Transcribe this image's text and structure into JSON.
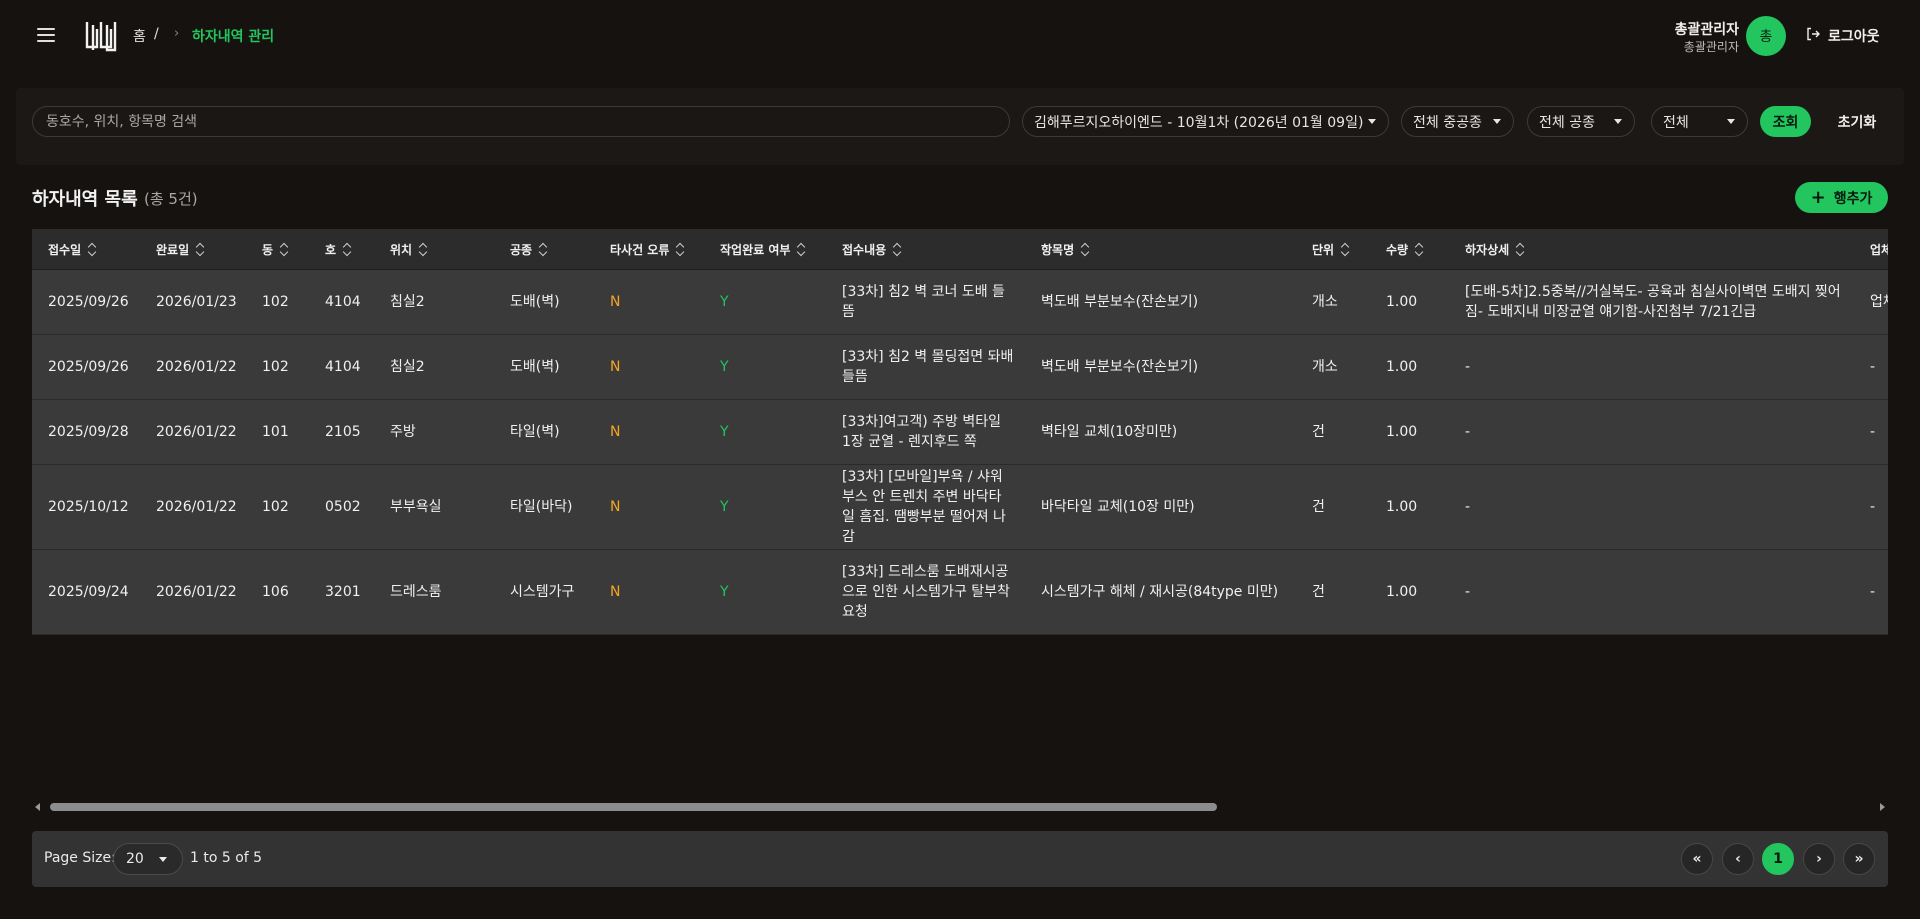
{
  "header": {
    "breadcrumb_home": "홈",
    "breadcrumb_sep": "/",
    "breadcrumb_current": "하자내역 관리",
    "user_name": "총괄관리자",
    "user_role": "총괄관리자",
    "avatar_initial": "총",
    "logout_label": "로그아웃"
  },
  "filters": {
    "search_placeholder": "동호수, 위치, 항목명 검색",
    "schedule_select": "김해푸르지오하이엔드 - 10월1차 (2026년 01월 09일)",
    "major_trade_select": "전체 중공종",
    "trade_select": "전체 공종",
    "status_select": "전체",
    "search_button": "조회",
    "reset_button": "초기화"
  },
  "list": {
    "title": "하자내역 목록",
    "count": "(총 5건)",
    "add_button": "행추가"
  },
  "table": {
    "columns": [
      "접수일",
      "완료일",
      "동",
      "호",
      "위치",
      "공종",
      "타사건 오류",
      "작업완료 여부",
      "접수내용",
      "항목명",
      "단위",
      "수량",
      "하자상세",
      "업체"
    ],
    "rows": [
      {
        "received": "2025/09/26",
        "completed": "2026/01/23",
        "dong": "102",
        "ho": "4104",
        "location": "침실2",
        "trade": "도배(벽)",
        "other_error": "N",
        "work_done": "Y",
        "content": "[33차] 침2 벽 코너 도배 들뜸",
        "item": "벽도배 부분보수(잔손보기)",
        "unit": "개소",
        "qty": "1.00",
        "detail": "[도배-5차]2.5중복//거실복도- 공육과 침실사이벽면 도배지 찢어짐- 도배지내 미장균열 얘기함-사진첨부 7/21긴급",
        "vendor": "업체"
      },
      {
        "received": "2025/09/26",
        "completed": "2026/01/22",
        "dong": "102",
        "ho": "4104",
        "location": "침실2",
        "trade": "도배(벽)",
        "other_error": "N",
        "work_done": "Y",
        "content": "[33차] 침2 벽 몰딩접면 돠배 들뜸",
        "item": "벽도배 부분보수(잔손보기)",
        "unit": "개소",
        "qty": "1.00",
        "detail": "-",
        "vendor": "-"
      },
      {
        "received": "2025/09/28",
        "completed": "2026/01/22",
        "dong": "101",
        "ho": "2105",
        "location": "주방",
        "trade": "타일(벽)",
        "other_error": "N",
        "work_done": "Y",
        "content": "[33차]여고객) 주방 벽타일 1장 균열 - 렌지후드 쪽",
        "item": "벽타일 교체(10장미만)",
        "unit": "건",
        "qty": "1.00",
        "detail": "-",
        "vendor": "-"
      },
      {
        "received": "2025/10/12",
        "completed": "2026/01/22",
        "dong": "102",
        "ho": "0502",
        "location": "부부욕실",
        "trade": "타일(바닥)",
        "other_error": "N",
        "work_done": "Y",
        "content": "[33차] [모바일]부욕 / 샤워부스 안 트렌치 주변 바닥타일 흠집. 땜빵부분 떨어져 나감",
        "item": "바닥타일 교체(10장 미만)",
        "unit": "건",
        "qty": "1.00",
        "detail": "-",
        "vendor": "-"
      },
      {
        "received": "2025/09/24",
        "completed": "2026/01/22",
        "dong": "106",
        "ho": "3201",
        "location": "드레스룸",
        "trade": "시스템가구",
        "other_error": "N",
        "work_done": "Y",
        "content": "[33차] 드레스룸 도배재시공으로 인한 시스템가구 탈부착 요청",
        "item": "시스템가구 해체 / 재시공(84type 미만)",
        "unit": "건",
        "qty": "1.00",
        "detail": "-",
        "vendor": "-"
      }
    ]
  },
  "pagination": {
    "page_size_label": "Page Size:",
    "page_size": "20",
    "range": "1 to 5 of 5",
    "first": "«",
    "prev": "‹",
    "current_page": "1",
    "next": "›",
    "last": "»"
  },
  "colors": {
    "accent": "#22c55e",
    "flag_n": "#f5a524",
    "background": "#16120f",
    "row_bg": "#3a3a3a",
    "header_bg": "#2c2c2c"
  },
  "icons": [
    "menu-icon",
    "logo-icon",
    "chevron-right-icon",
    "logout-icon",
    "plus-icon",
    "sort-icon",
    "caret-down-icon",
    "scroll-left-icon",
    "scroll-right-icon"
  ]
}
